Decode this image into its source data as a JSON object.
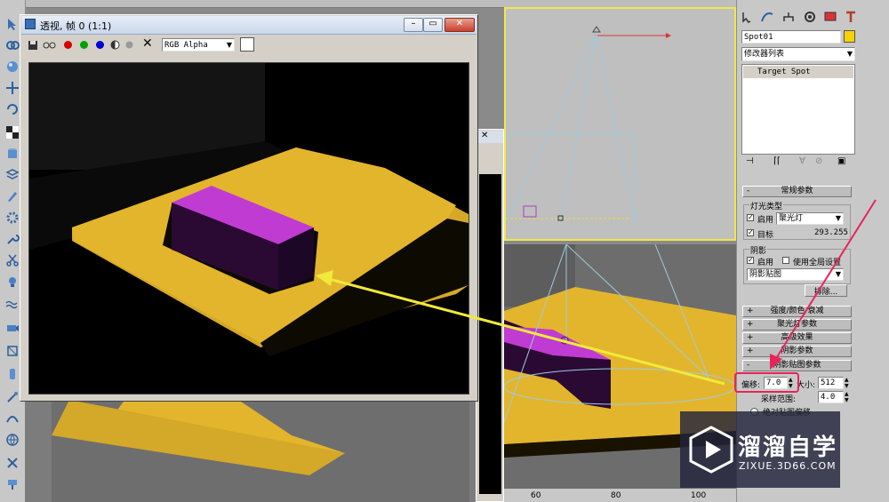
{
  "render_window": {
    "title": "透视, 帧 0 (1:1)",
    "channel_value": "RGB Alpha",
    "colors": {
      "red": "#d40000",
      "green": "#00a000",
      "blue": "#0000d0",
      "floor": "#e3b52c",
      "box_top": "#c03bd1",
      "box_side": "#2a0a33"
    }
  },
  "command_panel": {
    "object_name": "Spot01",
    "modifier_list_label": "修改器列表",
    "stack_item": "Target Spot",
    "rollouts": {
      "general": {
        "sign": "-",
        "title": "常规参数",
        "light_type_group": "灯光类型",
        "enable_label": "启用",
        "light_type_value": "聚光灯",
        "target_label": "目标",
        "target_distance": "293.255",
        "shadows_group": "阴影",
        "shadow_enable_label": "启用",
        "global_settings_label": "使用全局设置",
        "shadow_type_value": "阴影贴图",
        "exclude_label": "排除..."
      },
      "intensity": {
        "sign": "+",
        "title": "强度/颜色/衰减"
      },
      "spotlight": {
        "sign": "+",
        "title": "聚光灯参数"
      },
      "advanced": {
        "sign": "+",
        "title": "高级效果"
      },
      "shadow_params": {
        "sign": "+",
        "title": "阴影参数"
      },
      "shadow_map": {
        "sign": "-",
        "title": "阴影贴图参数",
        "bias_label": "偏移:",
        "bias_value": "7.0",
        "size_label": "大小:",
        "size_value": "512",
        "sample_range_label": "采样范围:",
        "sample_range_value": "4.0",
        "absolute_bias_label": "绝对贴图偏移"
      }
    }
  },
  "ruler": {
    "ticks": [
      "60",
      "80",
      "100"
    ]
  },
  "watermark": {
    "brand": "溜溜自学",
    "url": "ZIXUE.3D66.COM"
  }
}
